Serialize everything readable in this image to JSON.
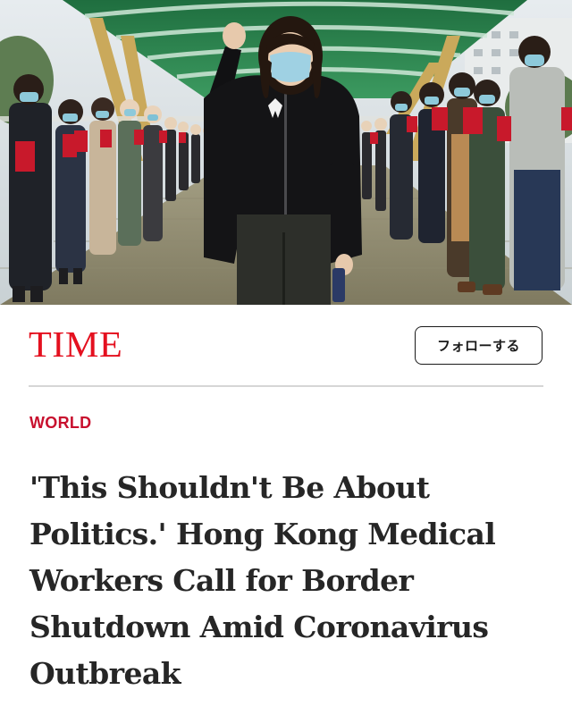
{
  "hero": {
    "description_icon": "photo-image"
  },
  "header": {
    "logo_text": "TIME",
    "follow_label": "フォローする"
  },
  "article": {
    "section": "WORLD",
    "headline": "'This Shouldn't Be About Politics.' Hong Kong Medical Workers Call for Border Shutdown Amid Coronavirus Outbreak"
  },
  "colors": {
    "brand_red": "#e4101f",
    "section_red": "#c8102e",
    "headline": "#262626",
    "canopy_green": "#2f8a53"
  }
}
